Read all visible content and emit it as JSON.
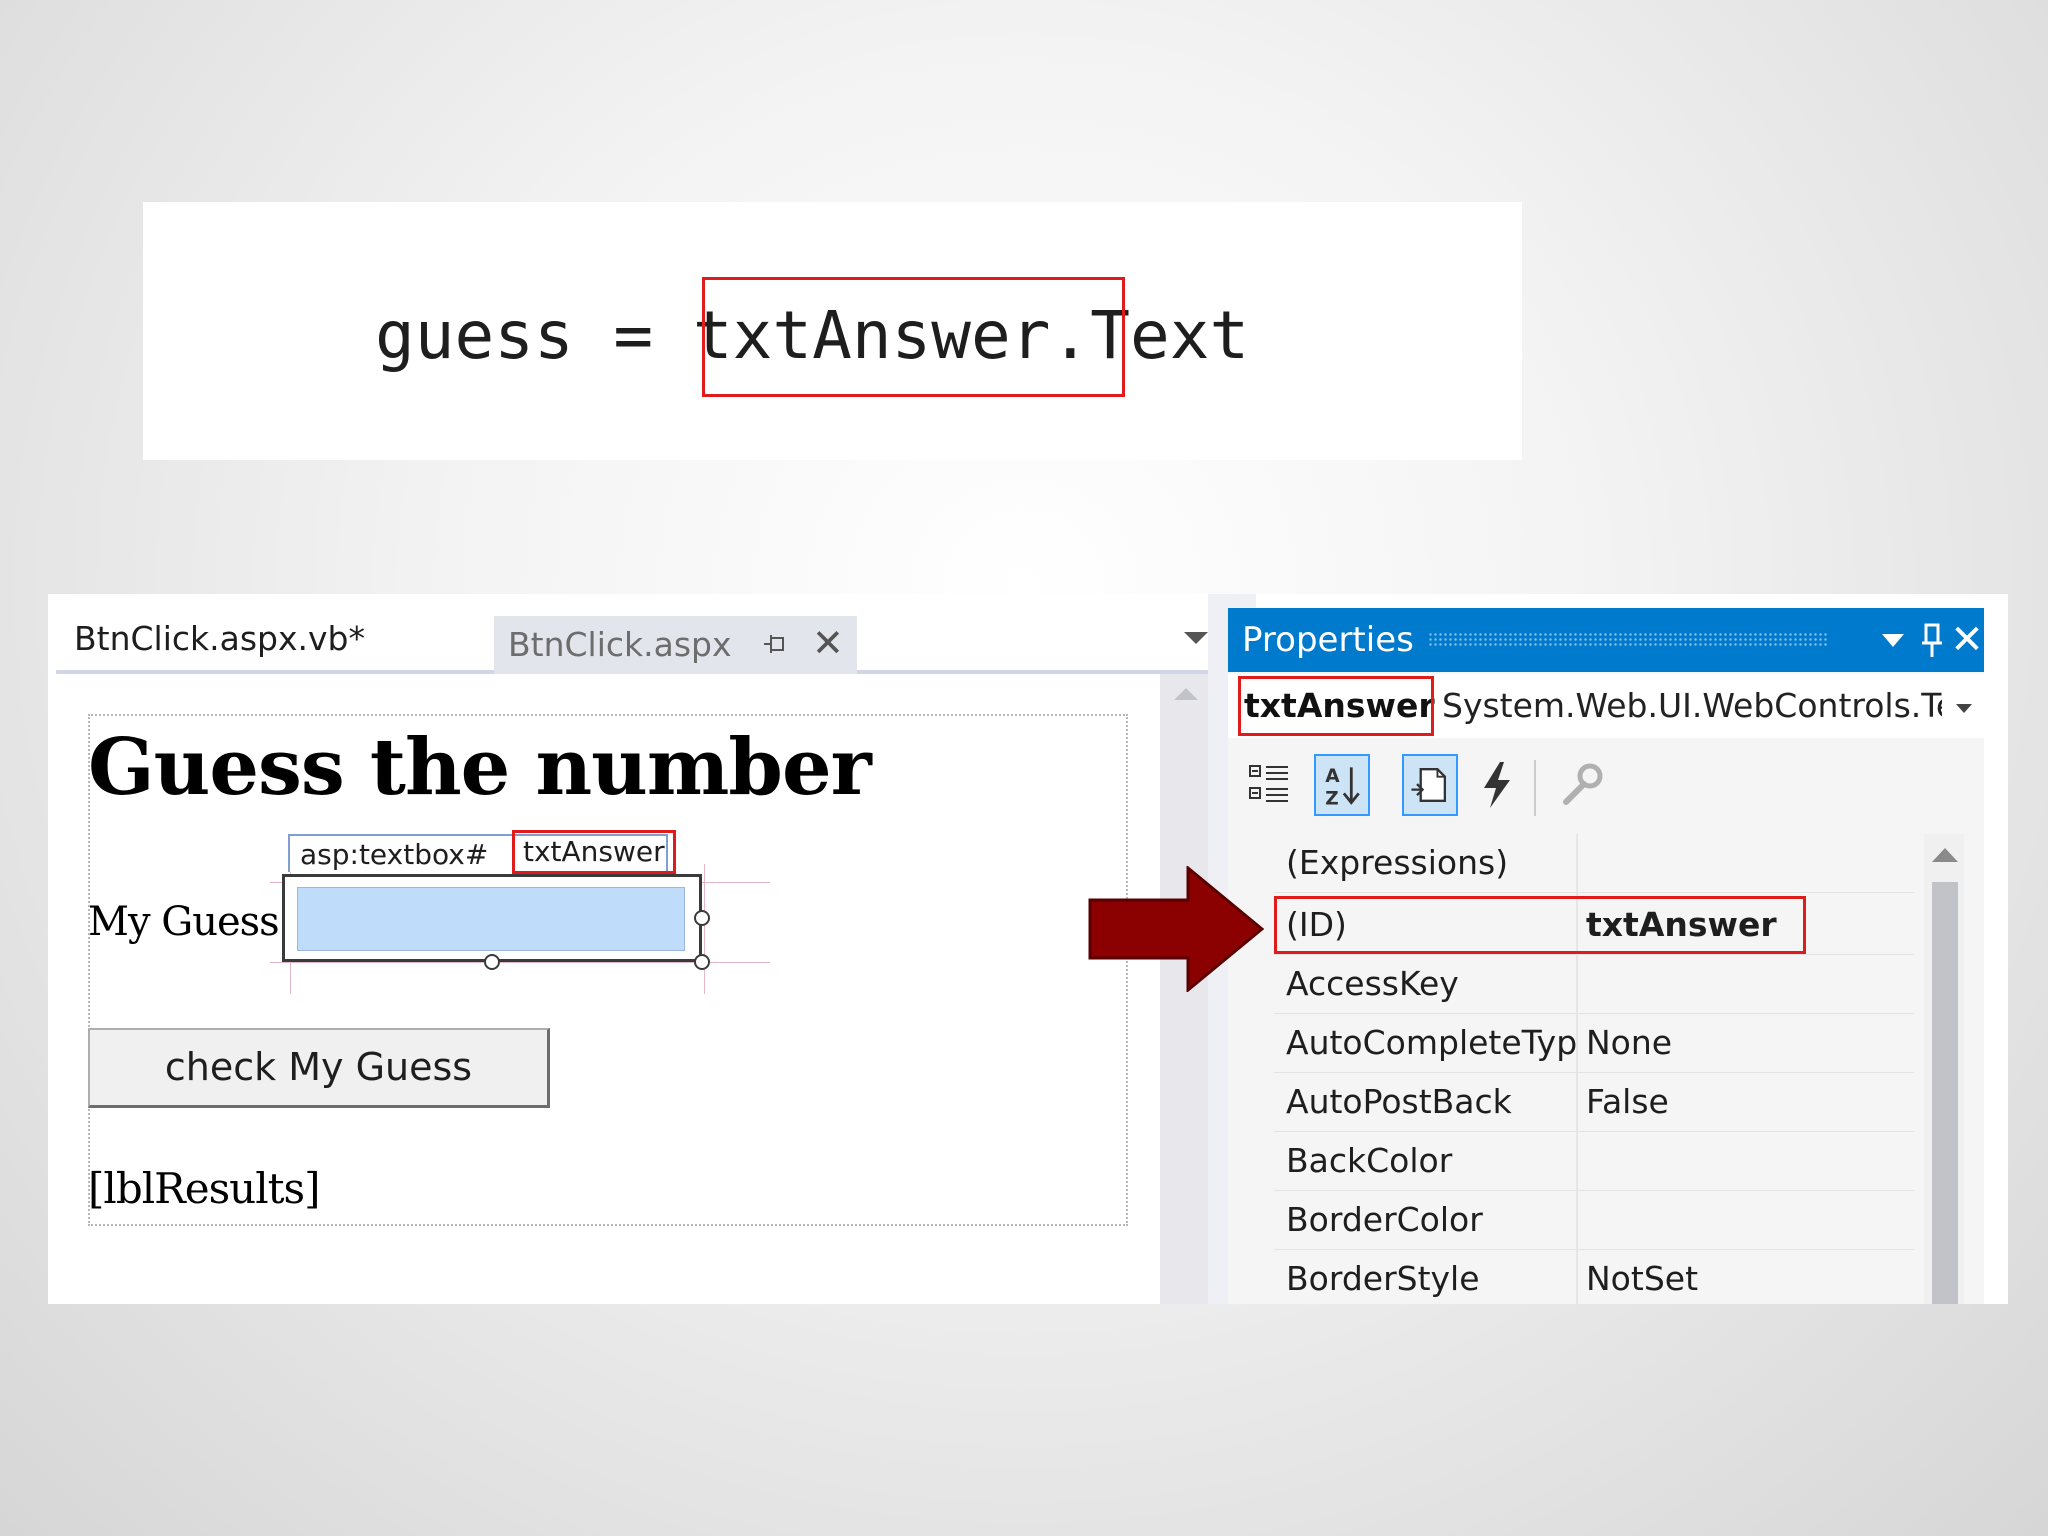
{
  "code": {
    "line": "guess = txtAnswer.Text",
    "highlight_token": "txtAnswer"
  },
  "editor": {
    "tabs": [
      {
        "label": "BtnClick.aspx.vb*",
        "active": true
      },
      {
        "label": "BtnClick.aspx",
        "active": false
      }
    ]
  },
  "design": {
    "heading": "Guess the number",
    "textbox_tag_prefix": "asp:textbox#",
    "textbox_tag_id": "txtAnswer",
    "label": "My Guess",
    "button_label": "check My Guess",
    "results_label": "[lblResults]"
  },
  "properties": {
    "title": "Properties",
    "object_id": "txtAnswer",
    "object_type": "System.Web.UI.WebControls.TextBox",
    "toolbar": [
      "categorized-icon",
      "alphabetical-icon",
      "properties-icon",
      "events-icon",
      "property-pages-icon"
    ],
    "rows": [
      {
        "name": "(Expressions)",
        "value": ""
      },
      {
        "name": "(ID)",
        "value": "txtAnswer"
      },
      {
        "name": "AccessKey",
        "value": ""
      },
      {
        "name": "AutoCompleteType",
        "value": "None"
      },
      {
        "name": "AutoPostBack",
        "value": "False"
      },
      {
        "name": "BackColor",
        "value": ""
      },
      {
        "name": "BorderColor",
        "value": ""
      },
      {
        "name": "BorderStyle",
        "value": "NotSet"
      }
    ]
  },
  "colors": {
    "highlight": "#e01b1b",
    "arrow": "#8b0000",
    "title_bar": "#007acc",
    "selected_input": "#bfdcfb"
  }
}
